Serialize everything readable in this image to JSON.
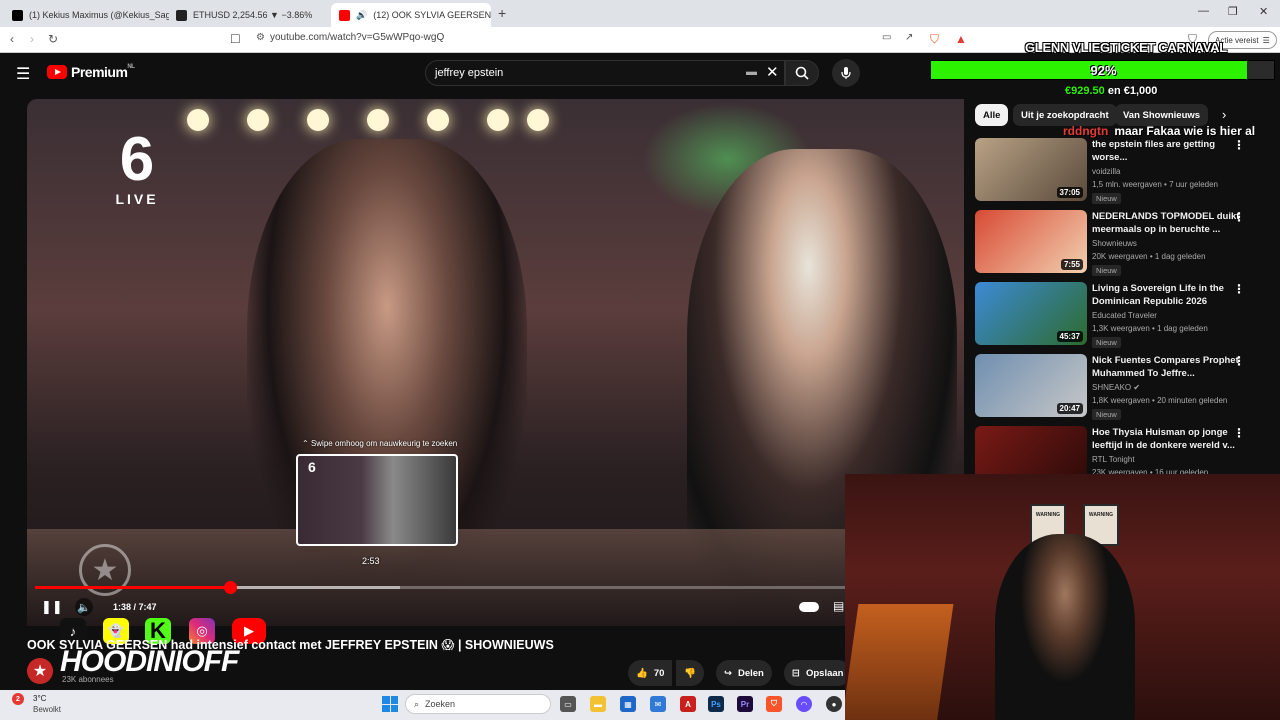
{
  "browser": {
    "tabs": [
      {
        "title": "(1) Kekius Maximus (@Kekius_Sage)",
        "icon": "x-icon",
        "active": false
      },
      {
        "title": "ETHUSD 2,254.56 ▼ −3.86%",
        "icon": "tradingview-icon",
        "active": false
      },
      {
        "title": "(12) OOK SYLVIA GEERSEN ha",
        "icon": "youtube-icon",
        "active": true
      }
    ],
    "url": "youtube.com/watch?v=G5wWPqo-wgQ",
    "profile_button": "Actie vereist"
  },
  "stream_overlay": {
    "goal_title": "GLENN VLIEGTICKET CARNAVAL",
    "goal_percent_text": "92%",
    "goal_progress": 0.92,
    "goal_current": "€929.50",
    "goal_separator": "en",
    "goal_target": "€1,000",
    "chat_user": "rddngtn",
    "chat_message": "maar Fakaa wie is hier al"
  },
  "youtube": {
    "logo_text": "Premium",
    "logo_region": "NL",
    "search_value": "jeffrey epstein",
    "video": {
      "channel_logo_number": "6",
      "channel_logo_label": "LIVE",
      "swipe_hint": "Swipe omhoog om nauwkeurig te zoeken",
      "preview_time": "2:53",
      "preview_logo": "6",
      "time_display": "1:38 / 7:47",
      "played_fraction": 0.24,
      "loaded_fraction": 0.45,
      "scrub_fraction": 0.43,
      "title": "OOK SYLVIA GEERSEN had intensief contact met JEFFREY EPSTEIN 😱 | SHOWNIEUWS",
      "subscribers": "23K abonnees",
      "likes": "70",
      "share_label": "Delen",
      "save_label": "Opslaan"
    },
    "chips": [
      "Alle",
      "Uit je zoekopdracht",
      "Van Shownieuws"
    ],
    "recommendations": [
      {
        "title": "the epstein files are getting worse...",
        "channel": "voidzilla",
        "meta": "1,5 mln. weergaven • 7 uur geleden",
        "duration": "37:05",
        "badge": "Nieuw",
        "verified": false,
        "colors": [
          "#b9a285",
          "#5a4a3c"
        ]
      },
      {
        "title": "NEDERLANDS TOPMODEL duikt meermaals op in beruchte ...",
        "channel": "Shownieuws",
        "meta": "20K weergaven • 1 dag geleden",
        "duration": "7:55",
        "badge": "Nieuw",
        "verified": false,
        "colors": [
          "#d84a34",
          "#f2d0b0"
        ]
      },
      {
        "title": "Living a Sovereign Life in the Dominican Republic 2026",
        "channel": "Educated Traveler",
        "meta": "1,3K weergaven • 1 dag geleden",
        "duration": "45:37",
        "badge": "Nieuw",
        "verified": false,
        "colors": [
          "#3c8ad6",
          "#2d6b2e"
        ]
      },
      {
        "title": "Nick Fuentes Compares Prophet Muhammed To Jeffre...",
        "channel": "SHNEAKO",
        "meta": "1,8K weergaven • 20 minuten geleden",
        "duration": "20:47",
        "badge": "Nieuw",
        "verified": true,
        "colors": [
          "#6f8fb0",
          "#c7c7c7"
        ]
      },
      {
        "title": "Hoe Thysia Huisman op jonge leeftijd in de donkere wereld v...",
        "channel": "RTL Tonight",
        "meta": "23K weergaven • 16 uur geleden",
        "duration": "",
        "badge": "",
        "verified": false,
        "colors": [
          "#7a1a16",
          "#2a0a08"
        ]
      }
    ]
  },
  "webcam_overlay": {
    "streamer_name": "HOODINIOFF",
    "signs": [
      "WARNING",
      "WARNING"
    ]
  },
  "taskbar": {
    "weather_temp": "3°C",
    "weather_desc": "Bewolkt",
    "notif_count": "2",
    "search_placeholder": "Zoeken"
  }
}
